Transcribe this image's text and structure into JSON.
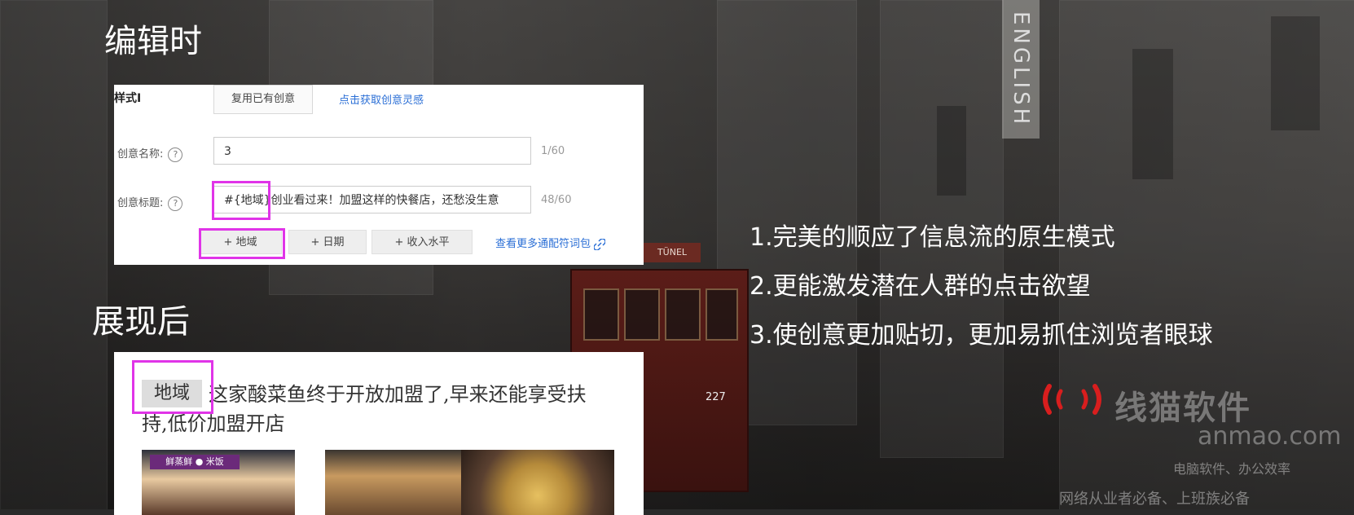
{
  "slide": {
    "edit_heading": "编辑时",
    "display_heading": "展现后"
  },
  "editor": {
    "style_label": "样式I",
    "reuse_button": "复用已有创意",
    "inspiration_link": "点击获取创意灵感",
    "name_label": "创意名称:",
    "name_value": "3",
    "name_count": "1/60",
    "title_label": "创意标题:",
    "title_value": "#{地域}创业看过来！加盟这样的快餐店，还愁没生意",
    "title_count": "48/60",
    "help_glyph": "?",
    "wildcard_buttons": [
      "+ 地域",
      "+ 日期",
      "+ 收入水平"
    ],
    "more_wildcards_link": "查看更多通配符词包"
  },
  "display": {
    "region_tag": "地域",
    "ad_text": "这家酸菜鱼终于开放加盟了,早来还能享受扶持,低价加盟开店",
    "thumb1_banner": "鲜蒸鲜 ● 米饭"
  },
  "points": [
    "1.完美的顺应了信息流的原生模式",
    "2.更能激发潜在人群的点击欲望",
    "3.使创意更加贴切，更加易抓住浏览者眼球"
  ],
  "watermark": {
    "name": "线猫软件",
    "url": "anmao.com",
    "slogan1": "电脑软件、办公效率",
    "slogan2": "网络从业者必备、上班族必备"
  },
  "background": {
    "sign_english": "ENGLISH",
    "sign_tunel": "TÜNEL",
    "tram_number": "227"
  },
  "colors": {
    "highlight": "#e034e8",
    "link": "#2b6fd6",
    "watermark_logo": "#d81e1e"
  }
}
